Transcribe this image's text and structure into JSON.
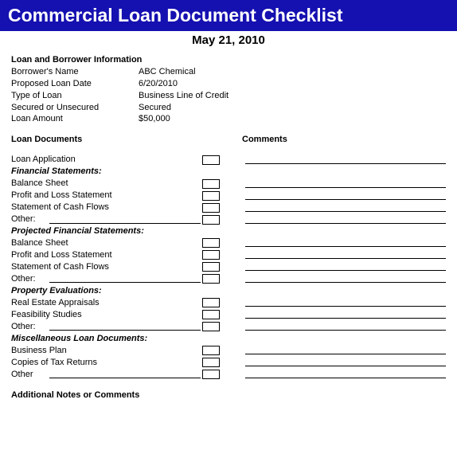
{
  "banner": "Commercial Loan Document Checklist",
  "date": "May 21, 2010",
  "info_head": "Loan and Borrower Information",
  "info": {
    "name_label": "Borrower's Name",
    "name_value": "ABC Chemical",
    "date_label": "Proposed Loan Date",
    "date_value": "6/20/2010",
    "type_label": "Type of Loan",
    "type_value": "Business Line of Credit",
    "sec_label": "Secured or Unsecured",
    "sec_value": "Secured",
    "amt_label": "Loan Amount",
    "amt_value": "$50,000"
  },
  "cols": {
    "docs": "Loan Documents",
    "comments": "Comments"
  },
  "docs": {
    "loan_app": "Loan Application",
    "fin_head": "Financial Statements:",
    "balance": "Balance Sheet",
    "pl": "Profit and Loss Statement",
    "cashflow": "Statement of Cash Flows",
    "other": "Other:",
    "proj_head": "Projected Financial Statements:",
    "prop_head": "Property Evaluations:",
    "appraisals": "Real Estate Appraisals",
    "feasibility": "Feasibility Studies",
    "misc_head": "Miscellaneous Loan Documents:",
    "bizplan": "Business Plan",
    "taxreturns": "Copies of Tax Returns",
    "other2": "Other"
  },
  "notes_head": "Additional Notes or Comments"
}
